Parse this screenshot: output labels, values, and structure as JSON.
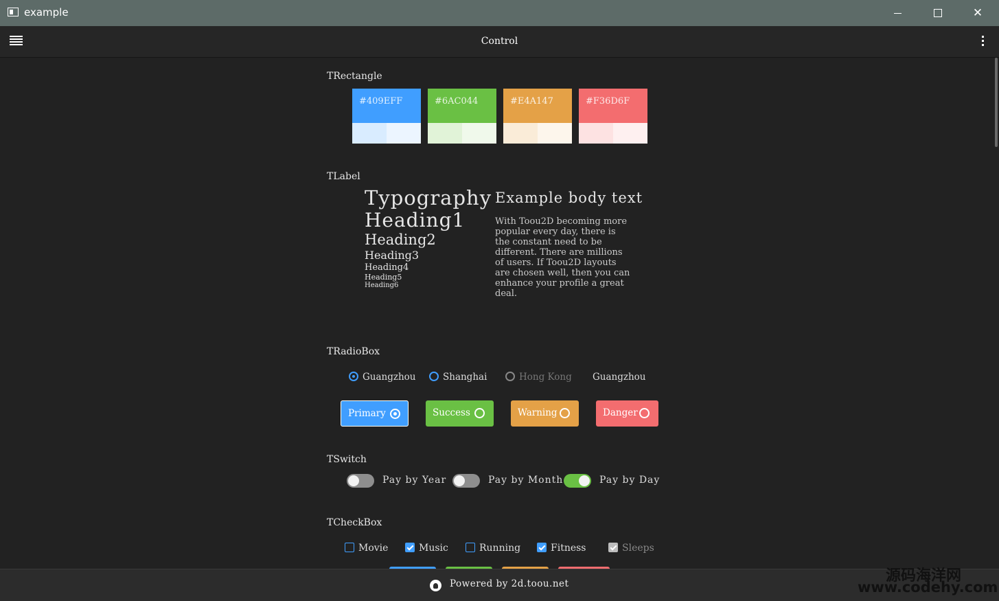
{
  "window": {
    "title": "example",
    "close_glyph": "✕"
  },
  "appbar": {
    "title": "Control",
    "menu_icon": "list-icon",
    "more_icon": "more-vertical-icon"
  },
  "sections": {
    "rectangle": "TRectangle",
    "label": "TLabel",
    "radiobox": "TRadioBox",
    "switch": "TSwitch",
    "checkbox": "TCheckBox"
  },
  "swatches": [
    {
      "label": "#409EFF",
      "color": "#409EFF",
      "light1": "#d9ecff",
      "light2": "#ecf5ff"
    },
    {
      "label": "#6AC044",
      "color": "#6AC044",
      "light1": "#e1f3d8",
      "light2": "#f0f9eb"
    },
    {
      "label": "#E4A147",
      "color": "#E4A147",
      "light1": "#faecd8",
      "light2": "#fdf6ec"
    },
    {
      "label": "#F36D6F",
      "color": "#F36D6F",
      "light1": "#fde2e2",
      "light2": "#fef0f0"
    }
  ],
  "typography": {
    "title": "Typography",
    "h1": "Heading1",
    "h2": "Heading2",
    "h3": "Heading3",
    "h4": "Heading4",
    "h5": "Heading5",
    "h6": "Heading6",
    "body_heading": "Example body text",
    "body_text": "With Toou2D becoming more popular every day, there is the constant need to be different. There are millions of users. If Toou2D layouts are chosen well, then you can enhance your profile a great deal."
  },
  "radios": [
    {
      "label": "Guangzhou",
      "state": "selected"
    },
    {
      "label": "Shanghai",
      "state": "normal"
    },
    {
      "label": "Hong Kong",
      "state": "disabled"
    }
  ],
  "radio_value": "Guangzhou",
  "radio_buttons": [
    {
      "label": "Primary",
      "color": "#409EFF",
      "selected": true
    },
    {
      "label": "Success",
      "color": "#6AC044",
      "selected": false
    },
    {
      "label": "Warning",
      "color": "#E4A147",
      "selected": false
    },
    {
      "label": "Danger",
      "color": "#F36D6F",
      "selected": false
    }
  ],
  "switches": [
    {
      "label": "Pay by Year",
      "on": false
    },
    {
      "label": "Pay by Month",
      "on": false
    },
    {
      "label": "Pay by Day",
      "on": true,
      "color": "#6AC044"
    }
  ],
  "checkboxes": [
    {
      "label": "Movie",
      "checked": false,
      "disabled": false
    },
    {
      "label": "Music",
      "checked": true,
      "disabled": false
    },
    {
      "label": "Running",
      "checked": false,
      "disabled": false
    },
    {
      "label": "Fitness",
      "checked": true,
      "disabled": false
    },
    {
      "label": "Sleeps",
      "checked": true,
      "disabled": true
    }
  ],
  "footer": {
    "text": "Powered by 2d.toou.net",
    "icon": "github-icon"
  },
  "watermark": {
    "line1": "源码海洋网",
    "line2": "www.codehy.com"
  }
}
